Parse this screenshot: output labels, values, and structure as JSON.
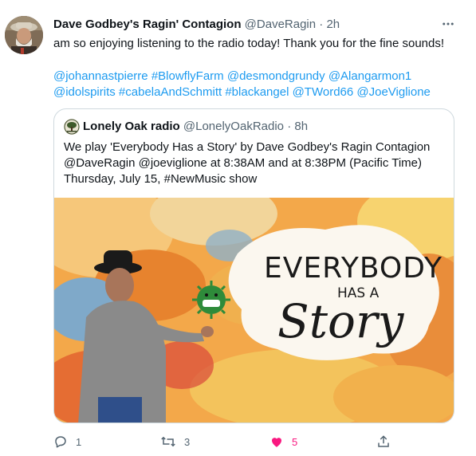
{
  "tweet": {
    "display_name": "Dave Godbey's Ragin' Contagion",
    "handle": "@DaveRagin",
    "separator": "·",
    "time": "2h",
    "text": "am so enjoying listening to the radio today! Thank you for the fine sounds!",
    "mentions": [
      "@johannastpierre",
      "#BlowflyFarm",
      "@desmondgrundy",
      "@Alangarmon1",
      "@idolspirits",
      "#cabelaAndSchmitt",
      "#blackangel",
      "@TWord66",
      "@JoeViglione"
    ]
  },
  "quoted": {
    "display_name": "Lonely Oak radio",
    "handle": "@LonelyOakRadio",
    "separator": "·",
    "time": "8h",
    "text": "We play 'Everybody Has a Story' by Dave Godbey's Ragin Contagion @DaveRagin @joeviglione at 8:38AM and at 8:38PM (Pacific Time) Thursday, July 15, #NewMusic show",
    "image_text": {
      "line1": "EVERYBODY",
      "line2": "HAS A",
      "line3": "Story"
    }
  },
  "actions": {
    "reply_count": "1",
    "retweet_count": "3",
    "like_count": "5",
    "liked": true
  },
  "colors": {
    "accent": "#1d9bf0",
    "like": "#f91880",
    "muted": "#536471",
    "border": "#cfd9de"
  },
  "icons": [
    "more-icon",
    "reply-icon",
    "retweet-icon",
    "heart-icon",
    "share-icon"
  ]
}
